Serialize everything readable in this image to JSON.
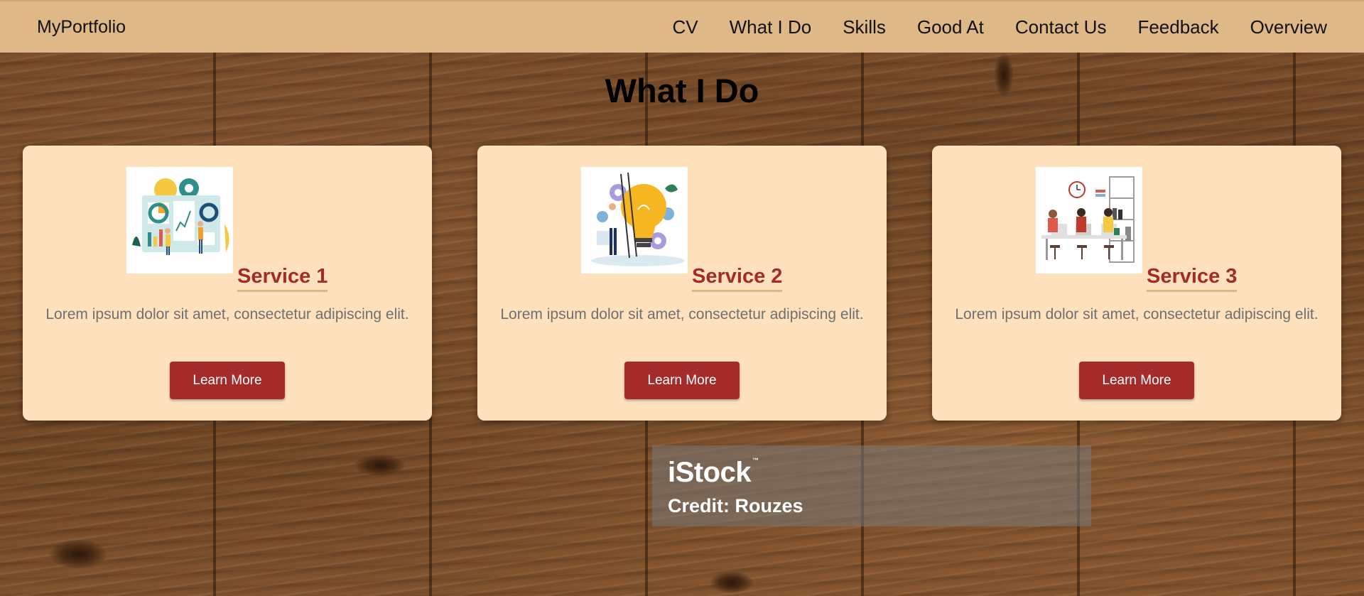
{
  "navbar": {
    "brand": "MyPortfolio",
    "links": [
      "CV",
      "What I Do",
      "Skills",
      "Good At",
      "Contact Us",
      "Feedback",
      "Overview"
    ]
  },
  "main": {
    "title": "What I Do",
    "services": [
      {
        "title": "Service 1",
        "description": "Lorem ipsum dolor sit amet, consectetur adipiscing elit.",
        "button": "Learn More",
        "image_icon": "analytics-dashboard-illustration"
      },
      {
        "title": "Service 2",
        "description": "Lorem ipsum dolor sit amet, consectetur adipiscing elit.",
        "button": "Learn More",
        "image_icon": "lightbulb-idea-illustration"
      },
      {
        "title": "Service 3",
        "description": "Lorem ipsum dolor sit amet, consectetur adipiscing elit.",
        "button": "Learn More",
        "image_icon": "team-workspace-illustration"
      }
    ]
  },
  "watermark": {
    "logo": "iStock",
    "tm": "™",
    "credit": "Credit: Rouzes"
  },
  "colors": {
    "navbar": "#deb887",
    "card": "#ffe1bd",
    "accent": "#a52a2a",
    "underline": "#deb887",
    "body_text": "#6f6f6f"
  }
}
